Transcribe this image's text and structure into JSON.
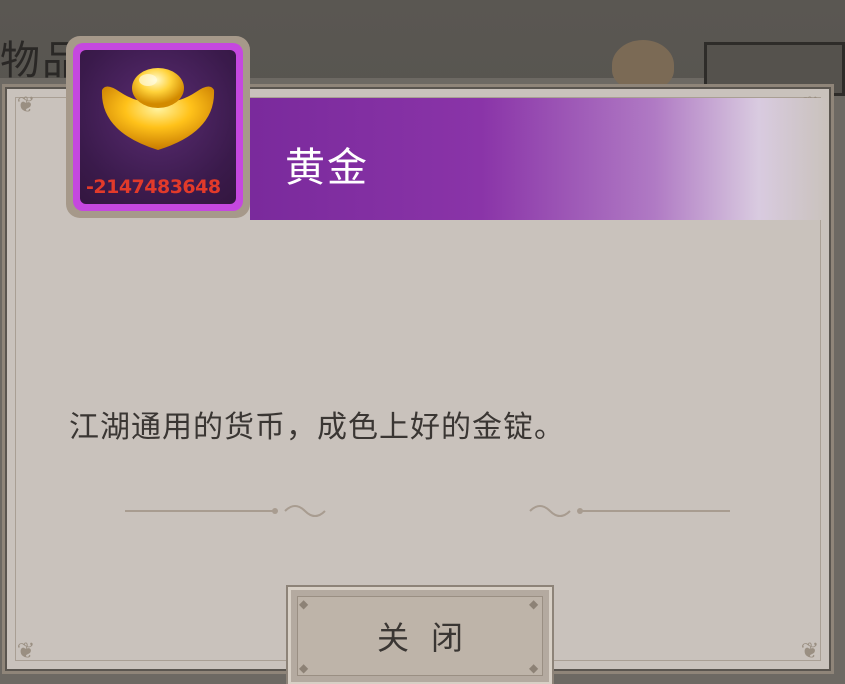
{
  "background": {
    "title": "物品"
  },
  "item": {
    "name": "黄金",
    "count": "-2147483648",
    "icon": "gold-ingot-icon",
    "description": "江湖通用的货币，成色上好的金锭。"
  },
  "buttons": {
    "close_label": "关闭"
  },
  "colors": {
    "header_purple": "#8a34a8",
    "frame_purple": "#c548df",
    "count_red": "#e23a2a",
    "dialog_bg": "#c9c2bc"
  }
}
